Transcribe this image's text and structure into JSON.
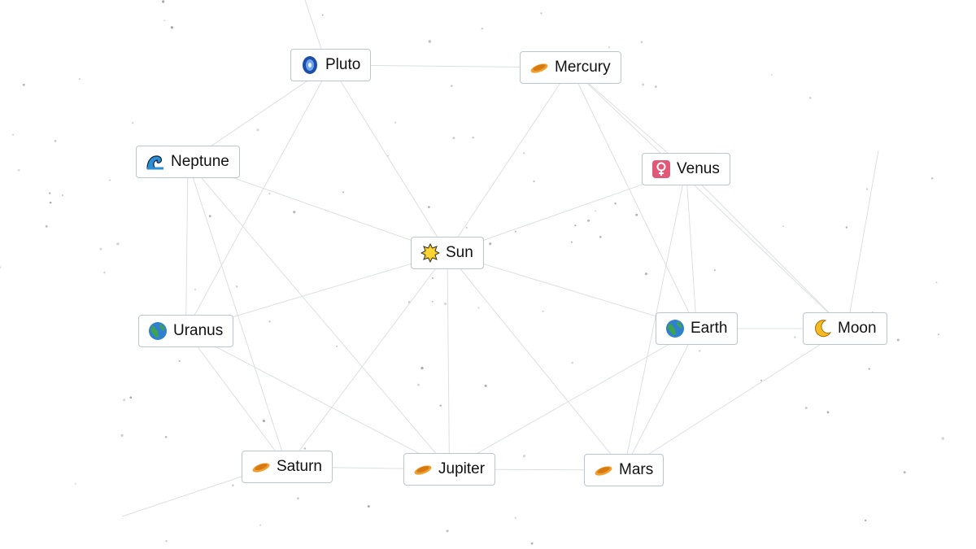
{
  "elements": [
    {
      "id": "pluto",
      "label": "Pluto",
      "icon": "galaxy-icon"
    },
    {
      "id": "mercury",
      "label": "Mercury",
      "icon": "ringed-planet-icon"
    },
    {
      "id": "neptune",
      "label": "Neptune",
      "icon": "wave-icon"
    },
    {
      "id": "venus",
      "label": "Venus",
      "icon": "female-sign-icon"
    },
    {
      "id": "sun",
      "label": "Sun",
      "icon": "sun-icon"
    },
    {
      "id": "uranus",
      "label": "Uranus",
      "icon": "globe-icon"
    },
    {
      "id": "earth",
      "label": "Earth",
      "icon": "globe-icon"
    },
    {
      "id": "moon",
      "label": "Moon",
      "icon": "crescent-moon-icon"
    },
    {
      "id": "saturn",
      "label": "Saturn",
      "icon": "ringed-planet-icon"
    },
    {
      "id": "jupiter",
      "label": "Jupiter",
      "icon": "ringed-planet-icon"
    },
    {
      "id": "mars",
      "label": "Mars",
      "icon": "ringed-planet-icon"
    }
  ],
  "connections": [
    [
      "pluto",
      "mercury"
    ],
    [
      "pluto",
      "neptune"
    ],
    [
      "pluto",
      "sun"
    ],
    [
      "pluto",
      "uranus"
    ],
    [
      "mercury",
      "venus"
    ],
    [
      "mercury",
      "sun"
    ],
    [
      "mercury",
      "earth"
    ],
    [
      "mercury",
      "moon"
    ],
    [
      "venus",
      "sun"
    ],
    [
      "venus",
      "earth"
    ],
    [
      "venus",
      "moon"
    ],
    [
      "venus",
      "mars"
    ],
    [
      "neptune",
      "sun"
    ],
    [
      "neptune",
      "uranus"
    ],
    [
      "neptune",
      "saturn"
    ],
    [
      "neptune",
      "jupiter"
    ],
    [
      "sun",
      "uranus"
    ],
    [
      "sun",
      "earth"
    ],
    [
      "sun",
      "jupiter"
    ],
    [
      "sun",
      "saturn"
    ],
    [
      "sun",
      "mars"
    ],
    [
      "uranus",
      "saturn"
    ],
    [
      "uranus",
      "jupiter"
    ],
    [
      "earth",
      "moon"
    ],
    [
      "earth",
      "mars"
    ],
    [
      "earth",
      "jupiter"
    ],
    [
      "moon",
      "mars"
    ],
    [
      "saturn",
      "jupiter"
    ],
    [
      "jupiter",
      "mars"
    ]
  ],
  "colors": {
    "node_border": "#b9c7cc",
    "line": "#dcdfe1",
    "dot": "#9a9a9a"
  }
}
